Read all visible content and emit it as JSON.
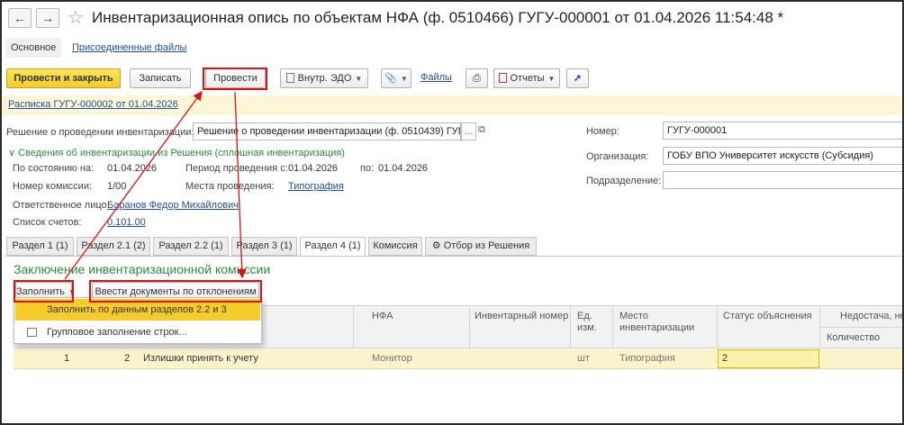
{
  "window": {
    "title": "Инвентаризационная опись по объектам НФА (ф. 0510466) ГУГУ-000001 от 01.04.2026 11:54:48 *",
    "back_icon": "arrow-left",
    "forward_icon": "arrow-right",
    "favorite_icon": "star-outline"
  },
  "top_tabs": {
    "main": "Основное",
    "attached": "Присоединенные файлы"
  },
  "toolbar": {
    "post_close": "Провести и закрыть",
    "save": "Записать",
    "post": "Провести",
    "edo": "Внутр. ЭДО",
    "files": "Файлы",
    "reports": "Отчеты"
  },
  "notice": {
    "link": "Расписка ГУГУ-000002 от 01.04.2026"
  },
  "form": {
    "decision_label": "Решение о проведении инвентаризации:",
    "decision_value": "Решение о проведении инвентаризации (ф. 0510439) ГУГУ-0",
    "decision_more": "...",
    "group_title": "Сведения об инвентаризации из Решения (сплошная инвентаризация)",
    "as_of_label": "По состоянию на:",
    "as_of_value": "01.04.2026",
    "period_label": "Период проведения с:",
    "period_from": "01.04.2026",
    "period_to_label": "по:",
    "period_to": "01.04.2026",
    "commission_label": "Номер комиссии:",
    "commission_value": "1/00",
    "places_label": "Места проведения:",
    "places_value": "Типография",
    "responsible_label": "Ответственное лицо:",
    "responsible_value": "Баранов Федор Михайлович",
    "accounts_label": "Список счетов:",
    "accounts_value": "0.101.00",
    "number_label": "Номер:",
    "number_value": "ГУГУ-000001",
    "org_label": "Организация:",
    "org_value": "ГОБУ ВПО Университет искусств (Субсидия)",
    "dept_label": "Подразделение:",
    "dept_value": ""
  },
  "section_tabs": [
    "Раздел 1 (1)",
    "Раздел 2.1 (2)",
    "Раздел 2.2 (1)",
    "Раздел 3 (1)",
    "Раздел 4 (1)",
    "Комиссия",
    "Отбор из Решения"
  ],
  "section_selected": "Раздел 4 (1)",
  "conclusion": {
    "title": "Заключение инвентаризационной комиссии",
    "fill_button": "Заполнить",
    "enter_docs_button": "Ввести документы по отклонениям"
  },
  "fill_menu": {
    "item1": "Заполнить по данным разделов 2.2 и 3",
    "item2": "Групповое заполнение строк..."
  },
  "table": {
    "headers": {
      "nfa": "НФА",
      "inventory_number": "Инвентарный номер",
      "unit": "Ед. изм.",
      "place": "Место инвентаризации",
      "status": "Статус объяснения",
      "shortage": "Недостача, не",
      "quantity": "Количество"
    },
    "rows": [
      {
        "n": "1",
        "code": "2",
        "decision": "Излишки принять к учету",
        "nfa": "Монитор",
        "inv_number": "",
        "unit": "шт",
        "place": "Типография",
        "status": "2"
      }
    ]
  },
  "colors": {
    "accent": "#f3cb2b",
    "link": "#1f4e9c",
    "group": "#2d8a3e",
    "annotation": "#e01010"
  }
}
